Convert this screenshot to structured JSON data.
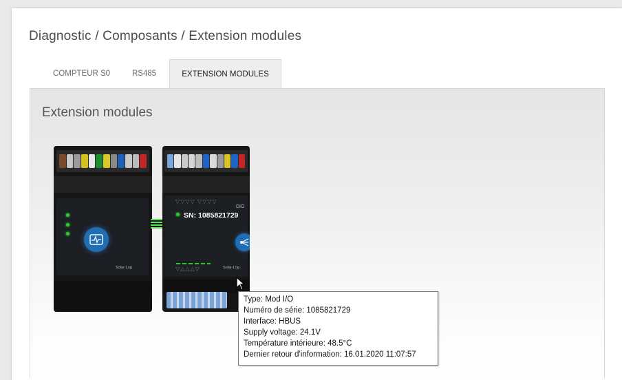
{
  "breadcrumb": "Diagnostic / Composants / Extension modules",
  "tabs": [
    {
      "label": "COMPTEUR S0",
      "active": false
    },
    {
      "label": "RS485",
      "active": false
    },
    {
      "label": "EXTENSION MODULES",
      "active": true
    }
  ],
  "panel": {
    "title": "Extension modules"
  },
  "modules": [
    {
      "brand": "Solar-Log"
    },
    {
      "label_dio": "DIO",
      "serial_label": "SN: 1085821729",
      "brand": "Solar-Log"
    }
  ],
  "tooltip": {
    "lines": [
      "Type: Mod I/O",
      "Numéro de série: 1085821729",
      "Interface: HBUS",
      "Supply voltage: 24.1V",
      "Température intérieure: 48.5°C",
      "Dernier retour d'information: 16.01.2020 11:07:57"
    ]
  },
  "colors": {
    "led": "#2ec92e",
    "accent": "#1a6fb8"
  }
}
